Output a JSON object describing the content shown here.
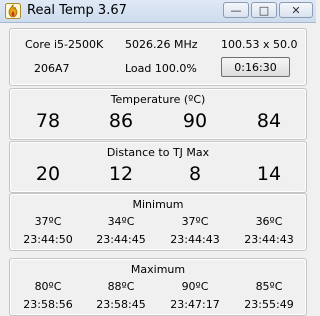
{
  "window": {
    "title": "Real Temp 3.67",
    "minimize_label": "—",
    "maximize_label": "□",
    "close_label": "✕"
  },
  "info": {
    "cpu_model": "Core i5-2500K",
    "frequency": "5026.26 MHz",
    "multiplier": "100.53 x 50.0",
    "cpuid": "206A7",
    "load": "Load 100.0%",
    "timer": "0:16:30"
  },
  "temperature": {
    "title": "Temperature (ºC)",
    "values": [
      "78",
      "86",
      "90",
      "84"
    ]
  },
  "distance": {
    "title": "Distance to TJ Max",
    "values": [
      "20",
      "12",
      "8",
      "14"
    ]
  },
  "minimum": {
    "title": "Minimum",
    "temps": [
      "37ºC",
      "34ºC",
      "37ºC",
      "36ºC"
    ],
    "times": [
      "23:44:50",
      "23:44:45",
      "23:44:43",
      "23:44:43"
    ]
  },
  "maximum": {
    "title": "Maximum",
    "temps": [
      "80ºC",
      "88ºC",
      "90ºC",
      "85ºC"
    ],
    "times": [
      "23:58:56",
      "23:58:45",
      "23:47:17",
      "23:55:49"
    ]
  }
}
